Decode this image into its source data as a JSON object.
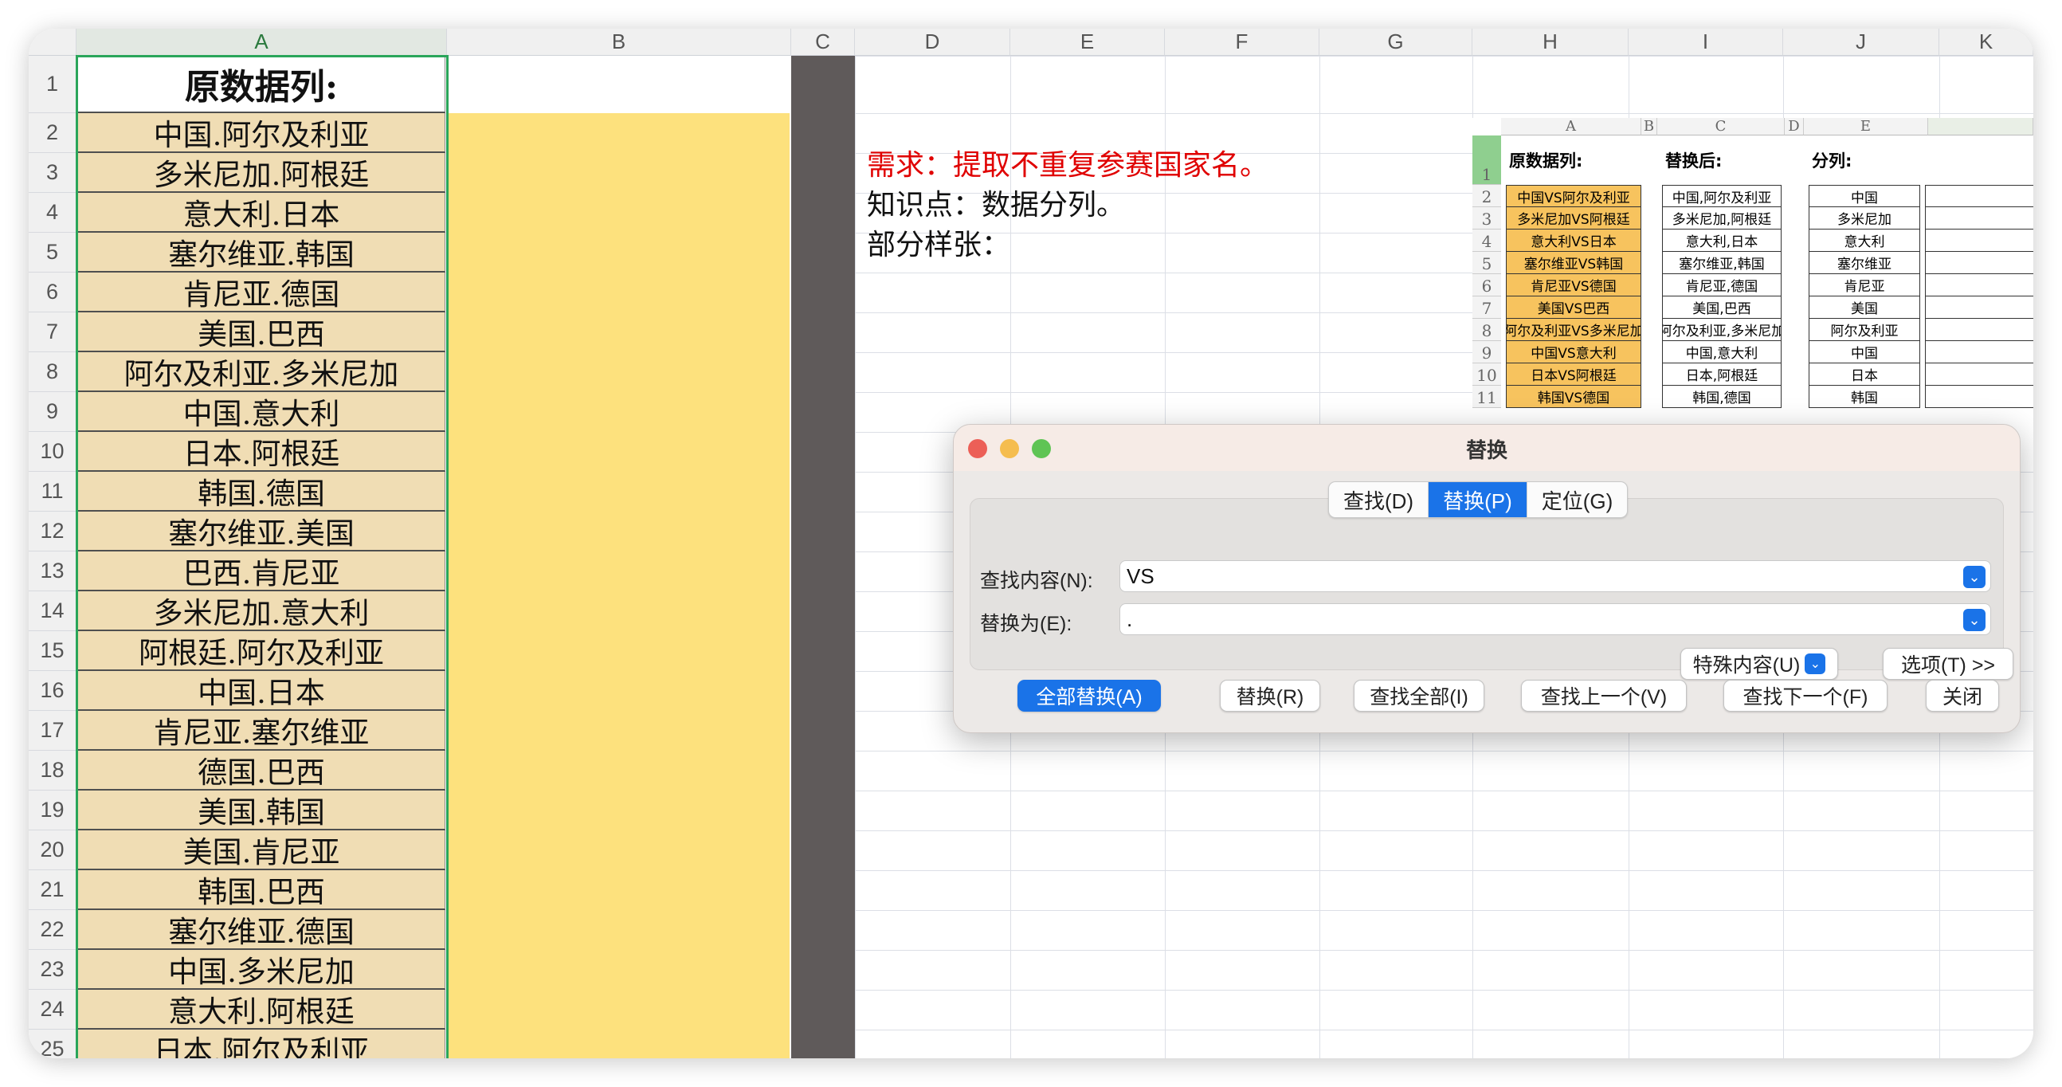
{
  "columns": [
    "A",
    "B",
    "C",
    "D",
    "E",
    "F",
    "G",
    "H",
    "I",
    "J",
    "K"
  ],
  "rows": [
    "1",
    "2",
    "3",
    "4",
    "5",
    "6",
    "7",
    "8",
    "9",
    "10",
    "11",
    "12",
    "13",
    "14",
    "15",
    "16",
    "17",
    "18",
    "19",
    "20",
    "21",
    "22",
    "23",
    "24",
    "25"
  ],
  "colA": {
    "header": "原数据列:",
    "values": [
      "中国.阿尔及利亚",
      "多米尼加.阿根廷",
      "意大利.日本",
      "塞尔维亚.韩国",
      "肯尼亚.德国",
      "美国.巴西",
      "阿尔及利亚.多米尼加",
      "中国.意大利",
      "日本.阿根廷",
      "韩国.德国",
      "塞尔维亚.美国",
      "巴西.肯尼亚",
      "多米尼加.意大利",
      "阿根廷.阿尔及利亚",
      "中国.日本",
      "肯尼亚.塞尔维亚",
      "德国.巴西",
      "美国.韩国",
      "美国.肯尼亚",
      "韩国.巴西",
      "塞尔维亚.德国",
      "中国.多米尼加",
      "意大利.阿根廷",
      "日本.阿尔及利亚"
    ]
  },
  "notes": {
    "requirement": "需求：提取不重复参赛国家名。",
    "knowledge": "知识点：数据分列。",
    "sample": "部分样张："
  },
  "inset": {
    "columns": [
      "A",
      "B",
      "C",
      "D",
      "E"
    ],
    "rows": [
      "1",
      "2",
      "3",
      "4",
      "5",
      "6",
      "7",
      "8",
      "9",
      "10",
      "11"
    ],
    "headers": {
      "a": "原数据列:",
      "c": "替换后:",
      "e": "分列:"
    },
    "colA": [
      "中国VS阿尔及利亚",
      "多米尼加VS阿根廷",
      "意大利VS日本",
      "塞尔维亚VS韩国",
      "肯尼亚VS德国",
      "美国VS巴西",
      "阿尔及利亚VS多米尼加",
      "中国VS意大利",
      "日本VS阿根廷",
      "韩国VS德国"
    ],
    "colC": [
      "中国,阿尔及利亚",
      "多米尼加,阿根廷",
      "意大利,日本",
      "塞尔维亚,韩国",
      "肯尼亚,德国",
      "美国,巴西",
      "阿尔及利亚,多米尼加",
      "中国,意大利",
      "日本,阿根廷",
      "韩国,德国"
    ],
    "colE": [
      "中国",
      "多米尼加",
      "意大利",
      "塞尔维亚",
      "肯尼亚",
      "美国",
      "阿尔及利亚",
      "中国",
      "日本",
      "韩国"
    ]
  },
  "dialog": {
    "title": "替换",
    "tabs": [
      "查找(D)",
      "替换(P)",
      "定位(G)"
    ],
    "find_label": "查找内容(N):",
    "find_value": "VS",
    "replace_label": "替换为(E):",
    "replace_value": ".",
    "special_label": "特殊内容(U)",
    "options_label": "选项(T) >>",
    "buttons": {
      "replace_all": "全部替换(A)",
      "replace": "替换(R)",
      "find_all": "查找全部(I)",
      "find_prev": "查找上一个(V)",
      "find_next": "查找下一个(F)",
      "close": "关闭"
    }
  },
  "colors": {
    "accent": "#1a73e8",
    "colA_fill": "#f0ddb4",
    "colB_fill": "#fde17d",
    "requirement_text": "#e00000",
    "selection": "#2aa55a"
  }
}
